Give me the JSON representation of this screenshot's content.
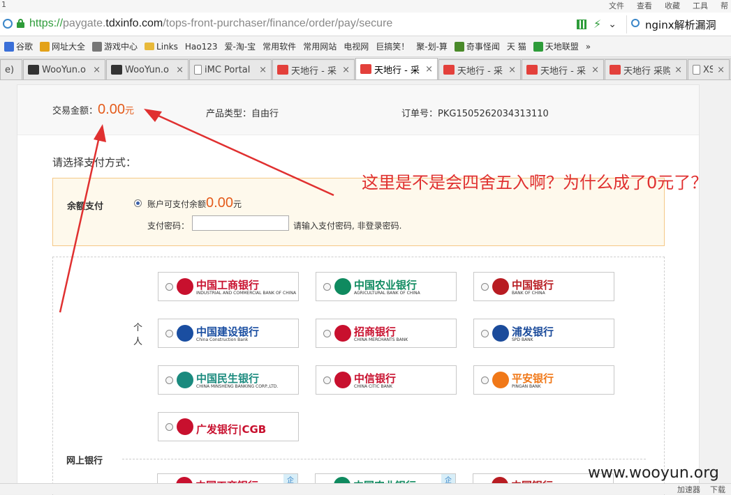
{
  "window": {
    "corner_num": "1",
    "menu": [
      "文件",
      "查看",
      "收藏",
      "工具",
      "帮"
    ]
  },
  "address_bar": {
    "scheme": "https://",
    "host_pre": "paygate.",
    "host": "tdxinfo.com",
    "path": "/tops-front-purchaser/finance/order/pay/secure",
    "search_query": "nginx解析漏洞"
  },
  "bookmarks": [
    {
      "label": "谷歌",
      "icon": "google-icon",
      "color": "#3a6fd8"
    },
    {
      "label": "网址大全",
      "icon": "plus-icon",
      "color": "#e3a21a"
    },
    {
      "label": "游戏中心",
      "icon": "gamepad-icon",
      "color": "#777777"
    },
    {
      "label": "Links",
      "icon": "folder-icon",
      "color": "#e8b93a"
    },
    {
      "label": "Hao123",
      "icon": "page-icon",
      "color": ""
    },
    {
      "label": "爱-淘-宝",
      "icon": "page-icon",
      "color": ""
    },
    {
      "label": "常用软件",
      "icon": "page-icon",
      "color": ""
    },
    {
      "label": "常用网站",
      "icon": "page-icon",
      "color": ""
    },
    {
      "label": "电视网",
      "icon": "page-icon",
      "color": ""
    },
    {
      "label": "巨搞笑！",
      "icon": "page-icon",
      "color": ""
    },
    {
      "label": "聚-划-算",
      "icon": "page-icon",
      "color": ""
    },
    {
      "label": "奇事怪闻",
      "icon": "leaf-icon",
      "color": "#4a8a2a"
    },
    {
      "label": "天 猫",
      "icon": "page-icon",
      "color": ""
    },
    {
      "label": "天地联盟",
      "icon": "tdlm-icon",
      "color": "#2e9c3a"
    },
    {
      "label": "»",
      "icon": "more-icon",
      "color": ""
    }
  ],
  "tabs": [
    {
      "label": "e)",
      "icon": "none",
      "active": false,
      "w": 32
    },
    {
      "label": "WooYun.o",
      "icon": "woo",
      "active": false,
      "w": 118
    },
    {
      "label": "WooYun.o",
      "icon": "woo",
      "active": false,
      "w": 118
    },
    {
      "label": "iMC Portal",
      "icon": "doc",
      "active": false,
      "w": 118
    },
    {
      "label": "天地行 - 采",
      "icon": "tdx",
      "active": false,
      "w": 118
    },
    {
      "label": "天地行 - 采",
      "icon": "tdx",
      "active": true,
      "w": 118
    },
    {
      "label": "天地行 - 采",
      "icon": "tdx",
      "active": false,
      "w": 118
    },
    {
      "label": "天地行 - 采",
      "icon": "tdx",
      "active": false,
      "w": 118
    },
    {
      "label": "天地行 采购",
      "icon": "tdx",
      "active": false,
      "w": 118
    },
    {
      "label": "XSS",
      "icon": "doc",
      "active": false,
      "w": 60
    }
  ],
  "order": {
    "amount_label": "交易金额：",
    "amount_value": "0.00",
    "amount_unit": "元",
    "product_type": "产品类型：自由行",
    "order_no": "订单号：PKG1505262034313110"
  },
  "payment": {
    "choose_label": "请选择支付方式：",
    "balance_title": "余额支付",
    "available_label": "账户可支付余额",
    "available_value": "0.00",
    "available_unit": "元",
    "password_label": "支付密码：",
    "password_value": "",
    "password_hint": "请输入支付密码, 非登录密码."
  },
  "personal_label": "个人",
  "banks": [
    {
      "name": "中国工商银行",
      "en": "INDUSTRIAL AND COMMERCIAL BANK OF CHINA",
      "color": "#c8102e"
    },
    {
      "name": "中国农业银行",
      "en": "AGRICULTURAL BANK OF CHINA",
      "color": "#0f8a5f"
    },
    {
      "name": "中国银行",
      "en": "BANK OF CHINA",
      "color": "#b81c22"
    },
    {
      "name": "中国建设银行",
      "en": "China Construction Bank",
      "color": "#1a4ea1"
    },
    {
      "name": "招商银行",
      "en": "CHINA MERCHANTS BANK",
      "color": "#c8102e"
    },
    {
      "name": "浦发银行",
      "en": "SPD BANK",
      "color": "#1b4b9b"
    },
    {
      "name": "中国民生银行",
      "en": "CHINA MINSHENG BANKING CORP.,LTD.",
      "color": "#1a8a7e"
    },
    {
      "name": "中信银行",
      "en": "CHINA CITIC BANK",
      "color": "#c8102e"
    },
    {
      "name": "平安银行",
      "en": "PINGAN BANK",
      "color": "#f07818"
    },
    {
      "name": "广发银行|CGB",
      "en": "",
      "color": "#c8102e"
    }
  ],
  "online_label": "网上银行",
  "online_tag": "企",
  "annotation": "这里是不是会四舍五入啊？为什么成了0元了？",
  "statusbar": [
    "加速器",
    "下载"
  ],
  "watermark": "www.wooyun.org",
  "accent_color": "#e45b1b",
  "annot_color": "#e03030"
}
